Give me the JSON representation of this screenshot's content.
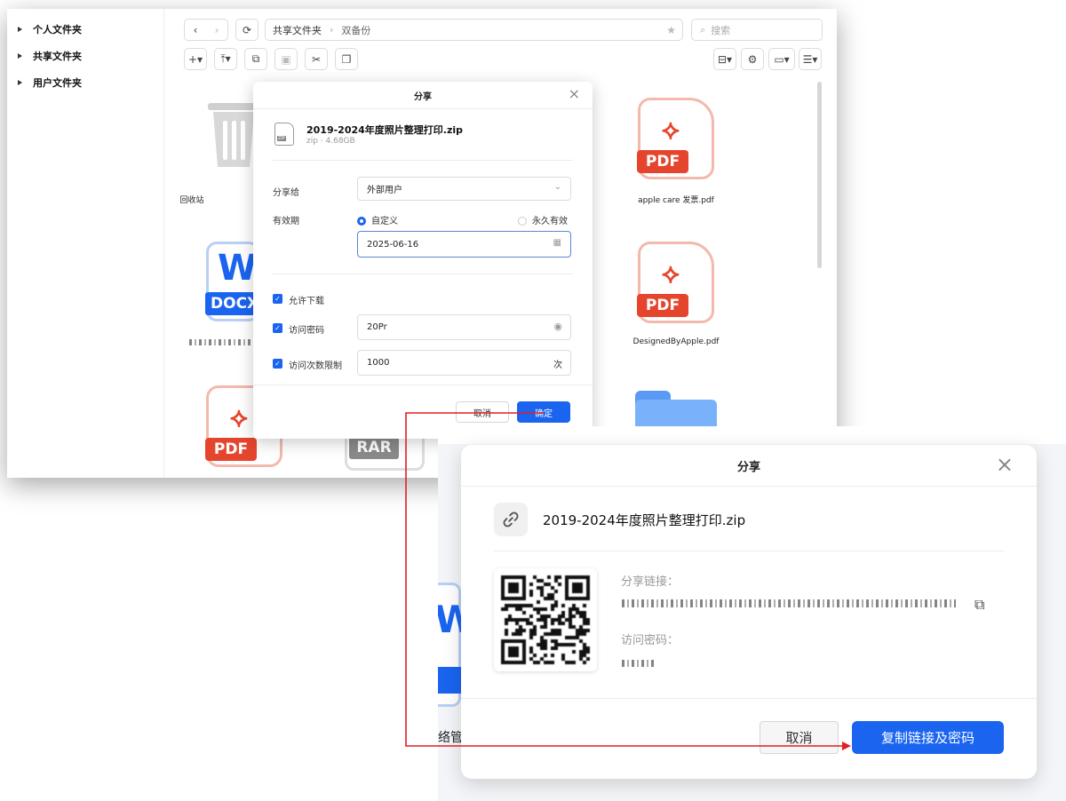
{
  "sidebar": {
    "items": [
      "个人文件夹",
      "共享文件夹",
      "用户文件夹"
    ]
  },
  "toolbar": {
    "back": "‹",
    "forward": "›",
    "refresh": "⟳",
    "breadcrumb": [
      "共享文件夹",
      "双备份"
    ],
    "search_placeholder": "搜索"
  },
  "files": [
    {
      "name": "回收站",
      "type": "trash"
    },
    {
      "name": "apple care 发票.pdf",
      "type": "pdf"
    },
    {
      "name": "DesignedByApple.pdf",
      "type": "pdf"
    }
  ],
  "file_badges": {
    "docx": "DOCX",
    "rar": "RAR",
    "pdf": "PDF"
  },
  "dialog_small": {
    "title": "分享",
    "file_name": "2019-2024年度照片整理打印.zip",
    "file_meta": "zip · 4.68GB",
    "share_to_label": "分享给",
    "share_to_value": "外部用户",
    "expiry_label": "有效期",
    "radio_custom": "自定义",
    "radio_forever": "永久有效",
    "date_value": "2025-06-16",
    "allow_download": "允许下载",
    "password_label": "访问密码",
    "password_value": "20Pr",
    "limit_label": "访问次数限制",
    "limit_value": "1000",
    "limit_unit": "次",
    "cancel": "取消",
    "confirm": "确定"
  },
  "dialog_large": {
    "title": "分享",
    "file_name": "2019-2024年度照片整理打印.zip",
    "link_label": "分享链接：",
    "password_label": "访问密码：",
    "cancel": "取消",
    "copy_button": "复制链接及密码"
  },
  "background_text": "络管理",
  "colors": {
    "accent": "#1a64f0",
    "pdf_red": "#e6452d",
    "arrow": "#e02020"
  }
}
